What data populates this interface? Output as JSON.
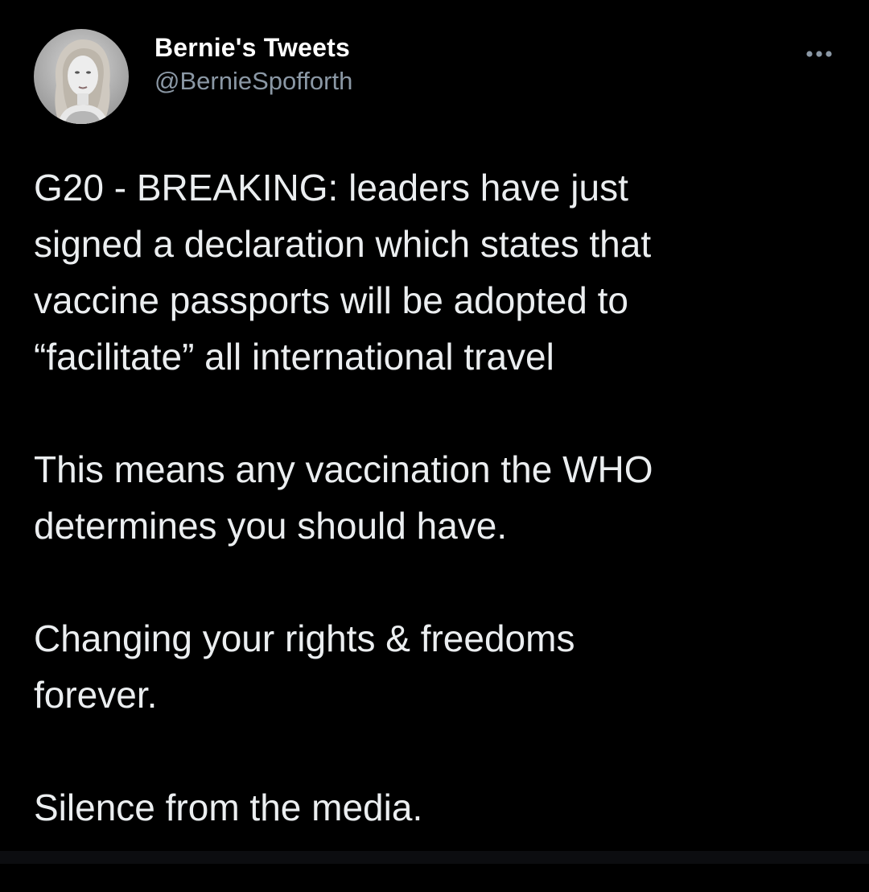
{
  "tweet": {
    "author": {
      "display_name": "Bernie's Tweets",
      "handle": "@BernieSpofforth",
      "avatar_icon": "avatar-portrait"
    },
    "more_icon": "more-options-icon",
    "paragraphs": [
      {
        "lines": [
          "G20 - BREAKING: leaders have just",
          "signed a declaration which states that",
          "vaccine passports will be adopted to",
          "“facilitate” all international travel"
        ]
      },
      {
        "lines": [
          "This means any vaccination the WHO",
          "determines you should have."
        ]
      },
      {
        "lines": [
          "Changing your rights & freedoms",
          "forever."
        ]
      },
      {
        "lines": [
          "Silence from the media."
        ]
      }
    ]
  },
  "colors": {
    "background": "#000000",
    "text_primary": "#e7e9ea",
    "text_secondary": "#8b98a5"
  }
}
